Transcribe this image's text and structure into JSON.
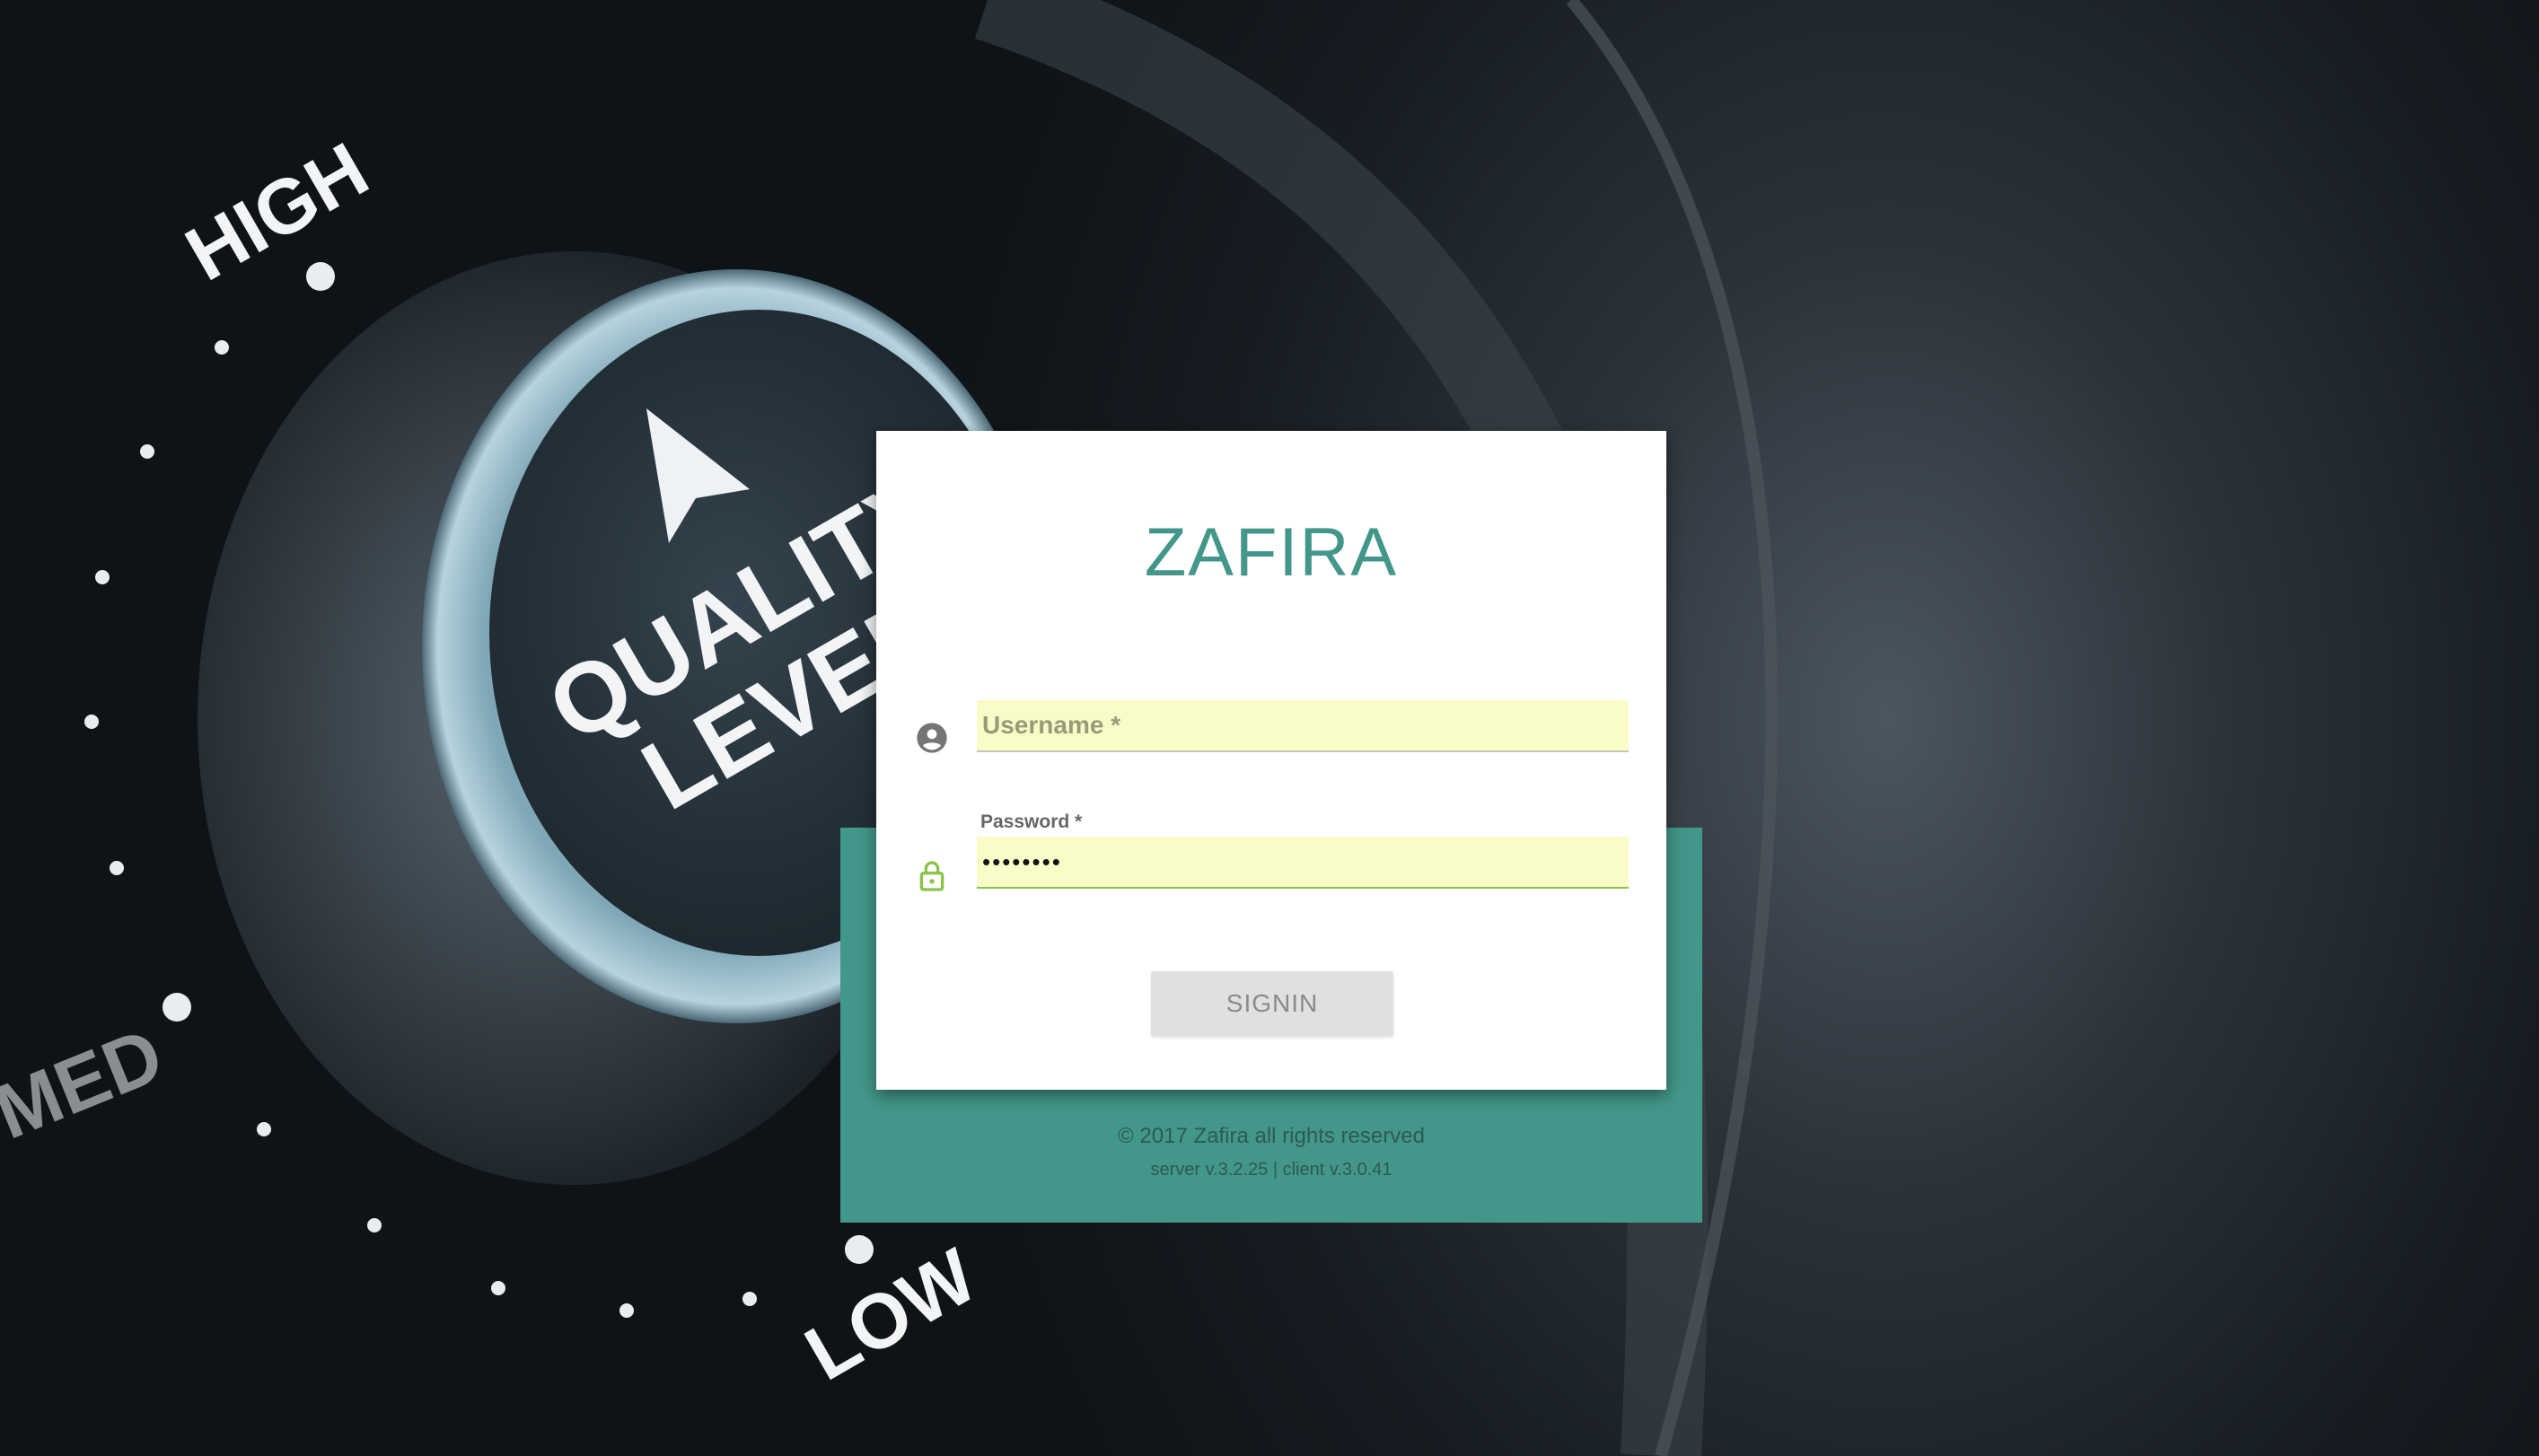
{
  "background": {
    "dial_labels": {
      "high": "HIGH",
      "med": "MED",
      "low": "LOW",
      "knob_line1": "QUALITY",
      "knob_line2": "LEVEL"
    }
  },
  "login": {
    "brand": "ZAFIRA",
    "username": {
      "placeholder": "Username *",
      "value": ""
    },
    "password": {
      "label": "Password *",
      "value": "12345678"
    },
    "submit_label": "SIGNIN"
  },
  "footer": {
    "copyright": "© 2017 Zafira all rights reserved",
    "version": "server v.3.2.25 | client v.3.0.41"
  },
  "colors": {
    "accent": "#43978a",
    "autofill": "#fafcc7",
    "lock_icon": "#8bc34a",
    "user_icon": "#757575"
  },
  "icons": [
    "account-circle-icon",
    "lock-icon"
  ]
}
